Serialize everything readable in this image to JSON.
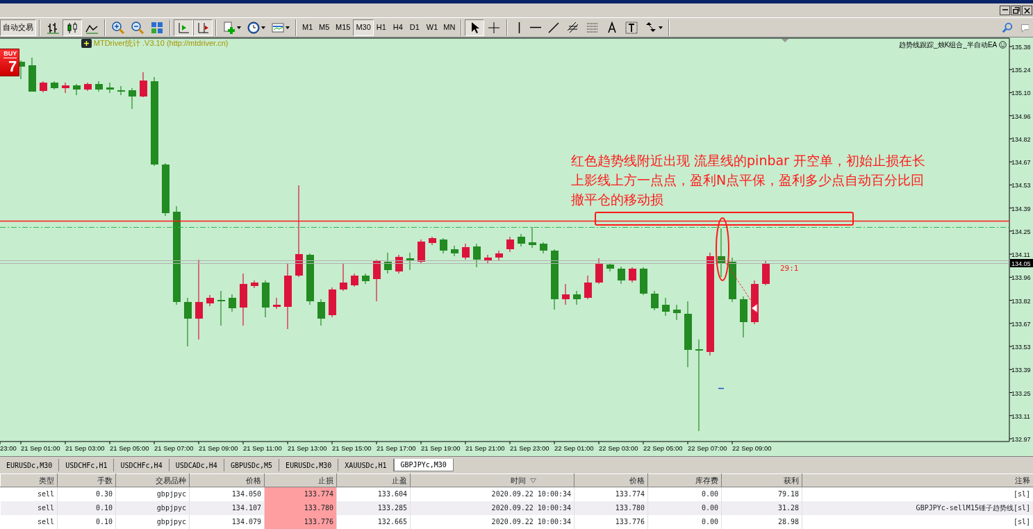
{
  "toolbar": {
    "autotrade_label": "自动交易",
    "tools": [
      {
        "kind": "bars",
        "pressed": false
      },
      {
        "kind": "candles",
        "pressed": true
      },
      {
        "kind": "line",
        "pressed": false
      },
      {
        "kind": "zoom-in",
        "pressed": false
      },
      {
        "kind": "zoom-out",
        "pressed": false
      },
      {
        "kind": "tile",
        "pressed": false
      },
      {
        "kind": "autoscroll",
        "pressed": true
      },
      {
        "kind": "shift",
        "pressed": true
      },
      {
        "kind": "new-chart",
        "pressed": false
      },
      {
        "kind": "clock",
        "pressed": false
      },
      {
        "kind": "template",
        "pressed": false
      }
    ],
    "timeframes": [
      {
        "label": "M1",
        "selected": false
      },
      {
        "label": "M5",
        "selected": false
      },
      {
        "label": "M15",
        "selected": false
      },
      {
        "label": "M30",
        "selected": true
      },
      {
        "label": "H1",
        "selected": false
      },
      {
        "label": "H4",
        "selected": false
      },
      {
        "label": "D1",
        "selected": false
      },
      {
        "label": "W1",
        "selected": false
      },
      {
        "label": "MN",
        "selected": false
      }
    ],
    "draw_tools": [
      {
        "kind": "cursor",
        "pressed": true
      },
      {
        "kind": "crosshair",
        "pressed": false
      },
      {
        "kind": "vline",
        "pressed": false
      },
      {
        "kind": "hline",
        "pressed": false
      },
      {
        "kind": "trend",
        "pressed": false
      },
      {
        "kind": "fibo-channel",
        "pressed": false
      },
      {
        "kind": "fibo-lines",
        "pressed": false
      },
      {
        "kind": "text",
        "pressed": false
      },
      {
        "kind": "label",
        "pressed": false
      },
      {
        "kind": "arrows",
        "pressed": false
      }
    ]
  },
  "chart": {
    "indicator_label": "MTDriver统计 .V3.10 (http://mtdriver.cn)",
    "ea_name": "趋势线跟踪_烛K组合_半自动EA",
    "buy_panel": {
      "label": "BUY",
      "price": "7"
    },
    "annotation": {
      "lines": [
        "红色趋势线附近出现 流星线的pinbar 开空单，初始止损在长",
        "上影线上方一点点，盈利N点平保，盈利多少点自动百分比回",
        "撤平仓的移动损"
      ]
    },
    "ratio_label": "29:1",
    "price_axis": [
      "135.38",
      "135.24",
      "135.10",
      "134.96",
      "134.82",
      "134.67",
      "134.53",
      "134.39",
      "134.25",
      "134.11",
      "133.96",
      "133.82",
      "133.67",
      "133.53",
      "133.39",
      "133.25",
      "133.11",
      "132.97"
    ],
    "current_price": "134.05",
    "time_axis": [
      "23:00",
      "21 Sep 01:00",
      "21 Sep 03:00",
      "21 Sep 05:00",
      "21 Sep 07:00",
      "21 Sep 09:00",
      "21 Sep 11:00",
      "21 Sep 13:00",
      "21 Sep 15:00",
      "21 Sep 17:00",
      "21 Sep 19:00",
      "21 Sep 21:00",
      "21 Sep 23:00",
      "22 Sep 01:00",
      "22 Sep 03:00",
      "22 Sep 05:00",
      "22 Sep 07:00",
      "22 Sep 09:00"
    ]
  },
  "tabs": [
    {
      "label": "EURUSDc,M30",
      "selected": false
    },
    {
      "label": "USDCHFc,H1",
      "selected": false
    },
    {
      "label": "USDCHFc,H4",
      "selected": false
    },
    {
      "label": "USDCADc,H4",
      "selected": false
    },
    {
      "label": "GBPUSDc,M5",
      "selected": false
    },
    {
      "label": "EURUSDc,M30",
      "selected": false
    },
    {
      "label": "XAUUSDc,H1",
      "selected": false
    },
    {
      "label": "GBPJPYc,M30",
      "selected": true
    }
  ],
  "orders": {
    "columns": [
      {
        "label": "类型",
        "sorted": false,
        "highlighted": false
      },
      {
        "label": "手数",
        "sorted": false,
        "highlighted": false
      },
      {
        "label": "交易品种",
        "sorted": false,
        "highlighted": false
      },
      {
        "label": "价格",
        "sorted": false,
        "highlighted": false
      },
      {
        "label": "止损",
        "sorted": false,
        "highlighted": true
      },
      {
        "label": "止盈",
        "sorted": false,
        "highlighted": false
      },
      {
        "label": "时间",
        "sorted": true,
        "highlighted": false
      },
      {
        "label": "价格",
        "sorted": false,
        "highlighted": false
      },
      {
        "label": "库存费",
        "sorted": false,
        "highlighted": false
      },
      {
        "label": "获利",
        "sorted": false,
        "highlighted": false
      },
      {
        "label": "注释",
        "sorted": false,
        "highlighted": false
      }
    ],
    "rows": [
      [
        "sell",
        "0.30",
        "gbpjpyc",
        "134.050",
        "133.774",
        "133.604",
        "2020.09.22 10:00:34",
        "133.774",
        "0.00",
        "79.18",
        "[sl]"
      ],
      [
        "sell",
        "0.10",
        "gbpjpyc",
        "134.107",
        "133.780",
        "133.285",
        "2020.09.22 10:00:34",
        "133.780",
        "0.00",
        "31.28",
        "GBPJPYc-sellM15锤子趋势线[sl]"
      ],
      [
        "sell",
        "0.10",
        "gbpjpyc",
        "134.079",
        "133.776",
        "132.665",
        "2020.09.22 10:00:34",
        "133.776",
        "0.00",
        "28.98",
        "[sl]"
      ]
    ]
  }
}
